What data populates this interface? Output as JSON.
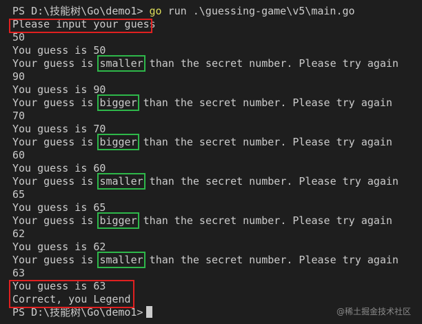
{
  "terminal": {
    "lines": [
      {
        "prompt": "PS D:\\技能树\\Go\\demo1>",
        "cmd": "go",
        "args": "run .\\guessing-game\\v5\\main.go"
      },
      {
        "text": "Please input your guess"
      },
      {
        "text": "50"
      },
      {
        "text": "You guess is 50"
      },
      {
        "pre": "Your guess is ",
        "word": "smaller",
        "post": " than the secret number. Please try again"
      },
      {
        "text": "90"
      },
      {
        "text": "You guess is 90"
      },
      {
        "pre": "Your guess is ",
        "word": "bigger",
        "post": " than the secret number. Please try again"
      },
      {
        "text": "70"
      },
      {
        "text": "You guess is 70"
      },
      {
        "pre": "Your guess is ",
        "word": "bigger",
        "post": " than the secret number. Please try again"
      },
      {
        "text": "60"
      },
      {
        "text": "You guess is 60"
      },
      {
        "pre": "Your guess is ",
        "word": "smaller",
        "post": " than the secret number. Please try again"
      },
      {
        "text": "65"
      },
      {
        "text": "You guess is 65"
      },
      {
        "pre": "Your guess is ",
        "word": "bigger",
        "post": " than the secret number. Please try again"
      },
      {
        "text": "62"
      },
      {
        "text": "You guess is 62"
      },
      {
        "pre": "Your guess is ",
        "word": "smaller",
        "post": " than the secret number. Please try again"
      },
      {
        "text": "63"
      },
      {
        "text": "You guess is 63"
      },
      {
        "text": "Correct, you Legend!"
      },
      {
        "prompt": "PS D:\\技能树\\Go\\demo1>"
      }
    ]
  },
  "watermark": "@稀土掘金技术社区",
  "colors": {
    "background": "#1e1e1e",
    "text": "#cccccc",
    "command": "#dcdc5a",
    "highlight_red": "#e02020",
    "highlight_green": "#2eb84a"
  }
}
